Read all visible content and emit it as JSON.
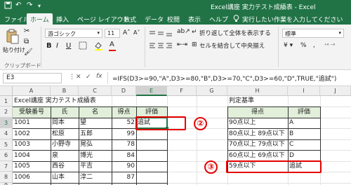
{
  "window": {
    "title": "Excel講座 実力テスト成績表 - Excel",
    "quick_access": [
      "save-icon",
      "undo-icon",
      "redo-icon",
      "dropdown-icon"
    ]
  },
  "menu": {
    "tabs": [
      "ファイル",
      "ホーム",
      "挿入",
      "ページ レイアウト",
      "数式",
      "データ",
      "校閲",
      "表示",
      "ヘルプ"
    ],
    "active_tab": "ホーム",
    "tell_me": "実行したい作業を入力してください"
  },
  "ribbon": {
    "paste_label": "貼り付け",
    "clipboard_label": "クリップボード",
    "font_name": "游ゴシック",
    "font_size": "11",
    "bold": "B",
    "italic": "I",
    "underline": "U",
    "wrap_text": "折り返して全体を表示する",
    "merge_center": "セルを結合して中央揃え",
    "number_format": "標準",
    "percent": "%",
    "comma": ","
  },
  "formula_bar": {
    "name_box": "E3",
    "cancel": "✕",
    "enter": "✓",
    "fx": "fx",
    "formula": "=IFS(D3>=90,\"A\",D3>=80,\"B\",D3>=70,\"C\",D3>=60,\"D\",TRUE,\"追試\")"
  },
  "sheet": {
    "columns": [
      "A",
      "B",
      "C",
      "D",
      "E",
      "F",
      "G",
      "H",
      "I",
      "J"
    ],
    "selected_column": "E",
    "rows": [
      "1",
      "2",
      "3",
      "4",
      "5",
      "6",
      "7",
      "8",
      "9"
    ],
    "selected_row": "3",
    "title": "Excel講座 実力テスト成績表",
    "headers": [
      "受験番号",
      "氏",
      "名",
      "得点",
      "評価"
    ],
    "records": [
      {
        "id": "1001",
        "sei": "岡本",
        "mei": "望",
        "score": "52",
        "grade": "追試"
      },
      {
        "id": "1002",
        "sei": "松原",
        "mei": "五郎",
        "score": "99",
        "grade": ""
      },
      {
        "id": "1003",
        "sei": "小野寺",
        "mei": "晃弘",
        "score": "78",
        "grade": ""
      },
      {
        "id": "1004",
        "sei": "泉",
        "mei": "博光",
        "score": "84",
        "grade": ""
      },
      {
        "id": "1005",
        "sei": "西谷",
        "mei": "平吉",
        "score": "90",
        "grade": ""
      },
      {
        "id": "1006",
        "sei": "山本",
        "mei": "淳二",
        "score": "87",
        "grade": ""
      }
    ],
    "criteria_title": "判定基準",
    "criteria_headers": [
      "得点",
      "評価"
    ],
    "criteria": [
      {
        "range": "90点以上",
        "grade": "A"
      },
      {
        "range": "80点以上 89点以下",
        "grade": "B"
      },
      {
        "range": "70点以上 79点以下",
        "grade": "C"
      },
      {
        "range": "60点以上 69点以下",
        "grade": "D"
      },
      {
        "range": "59点以下",
        "grade": "追試"
      }
    ]
  },
  "annotations": {
    "badge_2": "②",
    "badge_3": "③"
  },
  "colors": {
    "excel_green": "#217346",
    "header_fill": "#e2efda",
    "callout_red": "#e60000"
  }
}
